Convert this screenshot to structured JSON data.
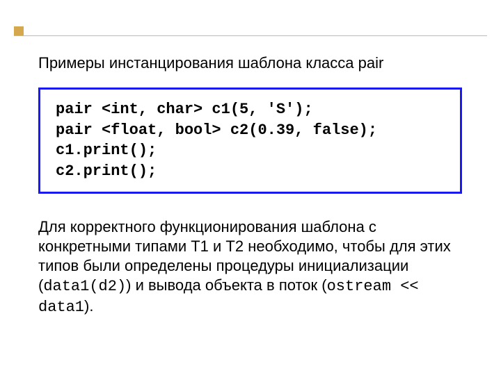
{
  "heading": "Примеры инстанцирования шаблона класса pair",
  "code": {
    "line1": "pair <int, char> c1(5, 'S');",
    "line2": "pair <float, bool> c2(0.39, false);",
    "line3": "c1.print();",
    "line4": "c2.print();"
  },
  "paragraph": {
    "p1": "Для корректного функционирования шаблона с конкретными типами T1 и T2 необходимо, чтобы для этих типов были определены процедуры инициализации (",
    "mono1": "data1(d2)",
    "p2": ") и вывода объекта в поток (",
    "mono2": "ostream << data1",
    "p3": ")."
  },
  "colors": {
    "accent": "#d6a84d",
    "border": "#1a1af0"
  }
}
